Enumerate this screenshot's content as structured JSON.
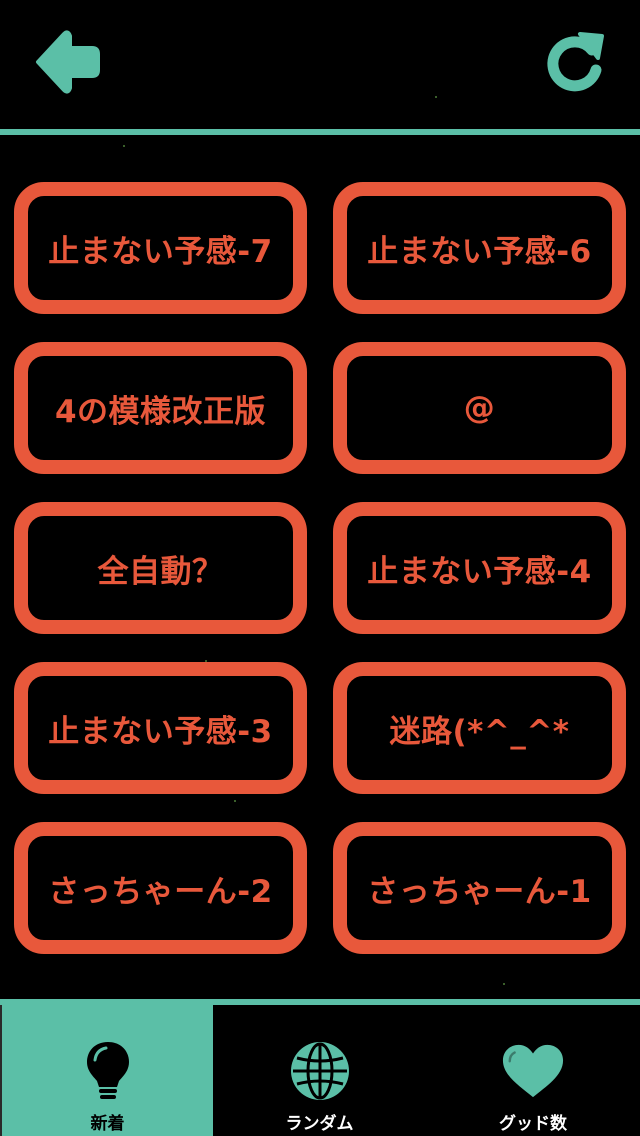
{
  "colors": {
    "background": "#000000",
    "accent": "#5bbfa7",
    "tile": "#e8583b",
    "tab_label": "#ffffff",
    "active_tab_label": "#000000"
  },
  "header": {
    "back_icon": "arrow-left-icon",
    "refresh_icon": "refresh-icon"
  },
  "tiles": [
    {
      "label": "止まない予感-7"
    },
    {
      "label": "止まない予感-6"
    },
    {
      "label": "4の模様改正版"
    },
    {
      "label": "@"
    },
    {
      "label": "全自動？"
    },
    {
      "label": "止まない予感-4"
    },
    {
      "label": "止まない予感-3"
    },
    {
      "label": "迷路(*^_^*"
    },
    {
      "label": "さっちゃーん-2"
    },
    {
      "label": "さっちゃーん-1"
    }
  ],
  "tabs": [
    {
      "label": "新着",
      "icon": "lightbulb-icon",
      "active": true
    },
    {
      "label": "ランダム",
      "icon": "globe-icon",
      "active": false
    },
    {
      "label": "グッド数",
      "icon": "heart-icon",
      "active": false
    }
  ]
}
